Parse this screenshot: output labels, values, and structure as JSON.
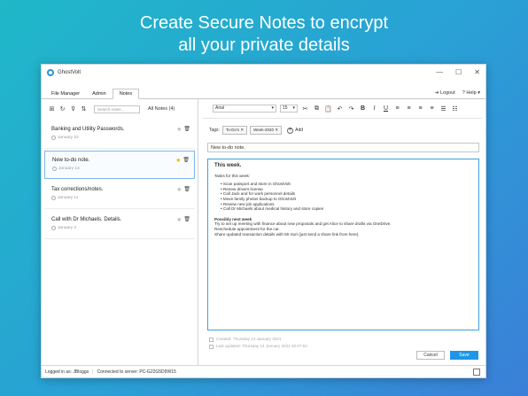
{
  "headline": {
    "line1": "Create Secure Notes to encrypt",
    "line2": "all your private details"
  },
  "window": {
    "title": "GhostVolt",
    "controls": {
      "minimize": "—",
      "maximize": "☐",
      "close": "✕"
    }
  },
  "menubar": {
    "tabs": [
      "File Manager",
      "Admin",
      "Notes"
    ],
    "active_tab": "Notes",
    "logout": "Logout",
    "help": "Help"
  },
  "notes_panel": {
    "search_placeholder": "Search notes...",
    "filter_label": "All Notes (4)",
    "notes": [
      {
        "title": "Banking and Utility Passwords.",
        "date": "January 22",
        "starred": false,
        "selected": false
      },
      {
        "title": "New to-do note.",
        "date": "January 14",
        "starred": true,
        "selected": true
      },
      {
        "title": "Tax corrections/notes.",
        "date": "January 11",
        "starred": false,
        "selected": false
      },
      {
        "title": "Call with Dr Michaels. Details.",
        "date": "January 2",
        "starred": false,
        "selected": false
      }
    ]
  },
  "editor_toolbar": {
    "font": "Arial",
    "size": "15"
  },
  "tags": {
    "label": "Tags:",
    "items": [
      "To-Do's",
      "Week-2020"
    ],
    "add_label": "Add"
  },
  "note_title": "New to-do note.",
  "note_body": {
    "heading": "This week.",
    "intro": "Tasks for this week:",
    "tasks": [
      "Scan passport and store in GhostVolt",
      "Renew drivers license",
      "Call Jack and for work personnel details",
      "Move family photos backup to GhostVolt",
      "Review new job applications",
      "Call Dr Michaels about medical history and store copies"
    ],
    "subheading": "Possibly next week",
    "lines": [
      "Try to set up meeting with finance about new proposals and get Alice to share drafts via OneDrive.",
      "Reschedule appointment for the car.",
      "Share updated transaction details with Mr Suri (just send a share link from here)."
    ]
  },
  "meta": {
    "created": "Created: Thursday 14 January 2021",
    "updated": "Last updated: Thursday 14 January 2021 00:07:53"
  },
  "buttons": {
    "cancel": "Cancel",
    "save": "Save"
  },
  "statusbar": {
    "logged_in": "Logged in as: JBloggs",
    "server": "Connected to server: PC-G22G5D9W15"
  },
  "colors": {
    "accent": "#1e96e8",
    "star": "#f2b705"
  }
}
